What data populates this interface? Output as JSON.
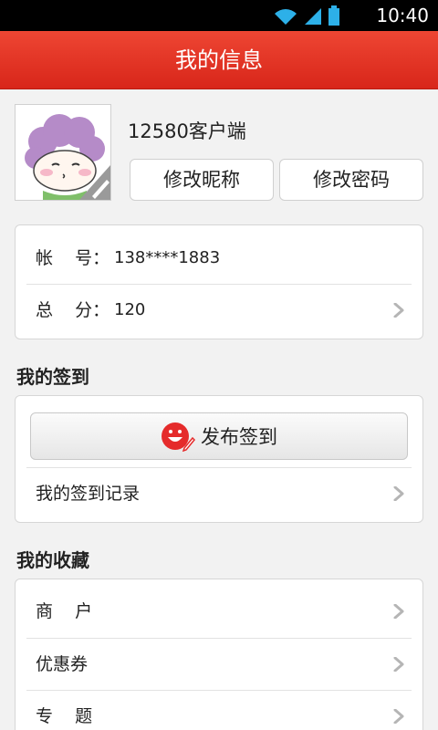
{
  "status_bar": {
    "time": "10:40",
    "icons": [
      "wifi-icon",
      "signal-icon",
      "battery-icon"
    ]
  },
  "header": {
    "title": "我的信息"
  },
  "profile": {
    "username": "12580客户端",
    "edit_nickname_label": "修改昵称",
    "edit_password_label": "修改密码"
  },
  "account": {
    "account_label": "帐    号：",
    "account_value": "138****1883",
    "score_label": "总    分：",
    "score_value": "120"
  },
  "checkin": {
    "section_title": "我的签到",
    "publish_label": "发布签到",
    "records_label": "我的签到记录"
  },
  "favorites": {
    "section_title": "我的收藏",
    "items": [
      "商    户",
      "优惠券",
      "专    题"
    ]
  },
  "colors": {
    "brand_red": "#e5372a",
    "background": "#f2f2f2",
    "smile_red": "#e52b2b"
  }
}
